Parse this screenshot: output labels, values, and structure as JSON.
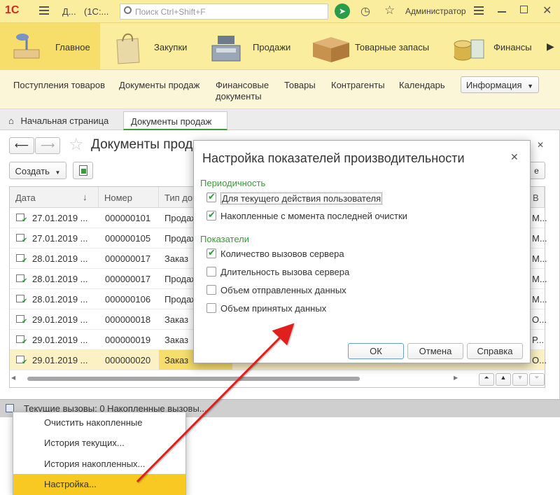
{
  "topbar": {
    "logo": "1C",
    "app_title": "Д...",
    "app_title2": "(1С:...",
    "search_placeholder": "Поиск Ctrl+Shift+F",
    "user": "Администратор"
  },
  "sections": [
    {
      "label": "Главное",
      "icon": "desk-lamp-icon"
    },
    {
      "label": "Закупки",
      "icon": "shopping-bag-icon"
    },
    {
      "label": "Продажи",
      "icon": "cash-register-icon"
    },
    {
      "label": "Товарные запасы",
      "icon": "box-icon"
    },
    {
      "label": "Финансы",
      "icon": "coins-icon"
    }
  ],
  "subnav": {
    "items": [
      "Поступления товаров",
      "Документы продаж",
      "Финансовые документы",
      "Товары",
      "Контрагенты",
      "Календарь"
    ],
    "info_button": "Информация"
  },
  "tabs": {
    "home": "Начальная страница",
    "active": "Документы продаж"
  },
  "form": {
    "title": "Документы продаж",
    "create_button": "Создать"
  },
  "grid": {
    "columns": [
      "Дата",
      "Номер",
      "Тип док",
      "В"
    ],
    "rows": [
      {
        "date": "27.01.2019 ...",
        "number": "000000101",
        "type": "Продаж",
        "v": "М..."
      },
      {
        "date": "27.01.2019 ...",
        "number": "000000105",
        "type": "Продаж",
        "v": "М..."
      },
      {
        "date": "28.01.2019 ...",
        "number": "000000017",
        "type": "Заказ",
        "v": "М..."
      },
      {
        "date": "28.01.2019 ...",
        "number": "000000017",
        "type": "Продаж",
        "v": "М..."
      },
      {
        "date": "28.01.2019 ...",
        "number": "000000106",
        "type": "Продаж",
        "v": "М..."
      },
      {
        "date": "29.01.2019 ...",
        "number": "000000018",
        "type": "Заказ",
        "v": "О..."
      },
      {
        "date": "29.01.2019 ...",
        "number": "000000019",
        "type": "Заказ",
        "v": "Р..."
      },
      {
        "date": "29.01.2019 ...",
        "number": "000000020",
        "type": "Заказ",
        "v": "О..."
      }
    ]
  },
  "statusbar": {
    "text": "Текущие вызовы: 0   Накопленные вызовы..."
  },
  "dialog": {
    "title": "Настройка показателей производительности",
    "group1": "Периодичность",
    "opt1": "Для текущего действия пользователя",
    "opt1_checked": true,
    "opt2": "Накопленные с момента последней очистки",
    "opt2_checked": true,
    "group2": "Показатели",
    "opt3": "Количество вызовов сервера",
    "opt3_checked": true,
    "opt4": "Длительность вызова сервера",
    "opt4_checked": false,
    "opt5": "Объем отправленных данных",
    "opt5_checked": false,
    "opt6": "Объем принятых данных",
    "opt6_checked": false,
    "ok": "ОК",
    "cancel": "Отмена",
    "help": "Справка"
  },
  "menu": {
    "items": [
      "Очистить накопленные",
      "История текущих...",
      "История накопленных...",
      "Настройка..."
    ]
  },
  "colors": {
    "accent": "#f7c922",
    "header_yellow": "#fbed9e",
    "arrow": "#e0201c",
    "group_green": "#3b9a3b"
  }
}
